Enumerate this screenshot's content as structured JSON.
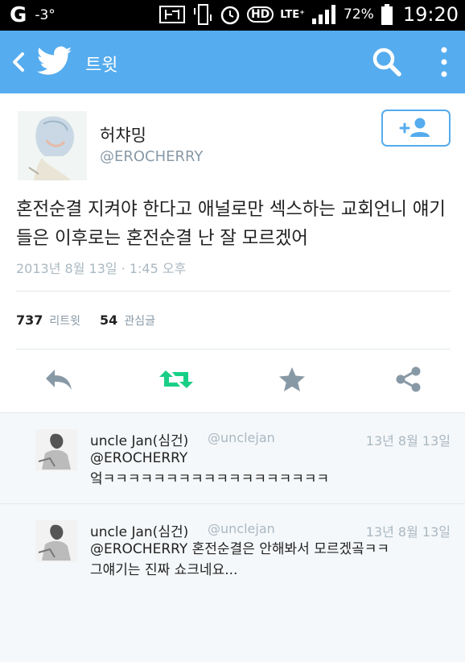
{
  "status_bar": {
    "carrier_glyph": "G",
    "temperature": "-3°",
    "lte": "LTE⁺",
    "hd": "HD",
    "battery": "72%",
    "clock": "19:20"
  },
  "app_bar": {
    "title": "트윗"
  },
  "tweet": {
    "name": "허챠밍",
    "handle": "@EROCHERRY",
    "text": "혼전순결 지켜야 한다고 애널로만 섹스하는 교회언니 얘기 들은 이후로는 혼전순결 난 잘 모르겠어",
    "timestamp": "2013년 8월 13일 · 1:45 오후",
    "retweets": "737",
    "retweets_label": "리트윗",
    "favorites": "54",
    "favorites_label": "관심글"
  },
  "replies": [
    {
      "name": "uncle Jan(심건)",
      "handle": "@unclejan",
      "date": "13년 8월 13일",
      "line1": "@EROCHERRY",
      "line2": "엌ㅋㅋㅋㅋㅋㅋㅋㅋㅋㅋㅋㅋㅋㅋㅋㅋㅋㅋ"
    },
    {
      "name": "uncle Jan(심건)",
      "handle": "@unclejan",
      "date": "13년 8월 13일",
      "line1": "@EROCHERRY 혼전순결은 안해봐서 모르겠곸ㅋㅋ",
      "line2": "그얘기는 진짜 쇼크네요..."
    }
  ],
  "colors": {
    "accent": "#55acee",
    "retweet_green": "#19cf86",
    "icon_gray": "#8899a6"
  },
  "icons": [
    "back-icon",
    "twitter-bird-icon",
    "search-icon",
    "more-icon",
    "follow-icon",
    "reply-icon",
    "retweet-icon",
    "favorite-icon",
    "share-icon"
  ]
}
